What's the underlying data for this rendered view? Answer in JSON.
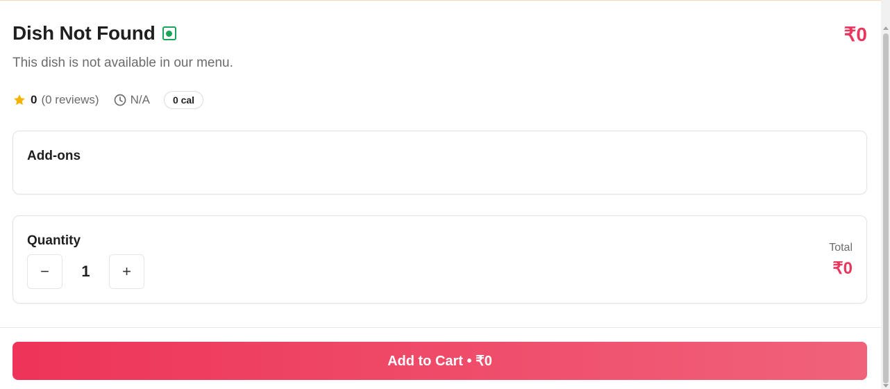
{
  "dish": {
    "title": "Dish Not Found",
    "veg_indicator": "veg-icon",
    "price": "₹0",
    "description": "This dish is not available in our menu."
  },
  "meta": {
    "rating": "0",
    "reviews": "(0 reviews)",
    "time": "N/A",
    "calories": "0 cal"
  },
  "addons": {
    "title": "Add-ons"
  },
  "quantity": {
    "title": "Quantity",
    "decrement_label": "−",
    "value": "1",
    "increment_label": "+",
    "total_label": "Total",
    "total_value": "₹0"
  },
  "cart": {
    "button_label": "Add to Cart • ₹0"
  },
  "colors": {
    "accent": "#e8365d",
    "veg": "#18a558",
    "star": "#f5b301"
  }
}
